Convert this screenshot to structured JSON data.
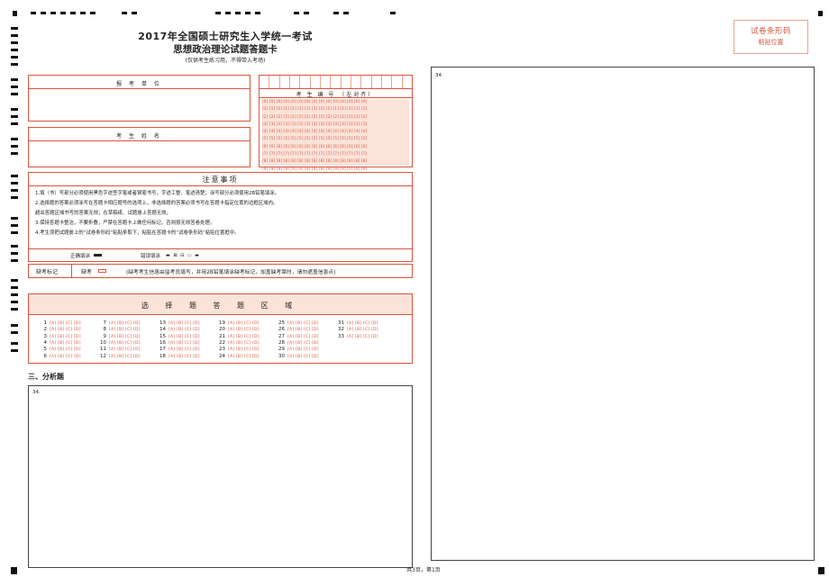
{
  "header": {
    "title_line1": "2017年全国硕士研究生入学统一考试",
    "title_line2": "思想政治理论试题答题卡",
    "subtitle": "(仅供考生练习用，不得带入考场)"
  },
  "barcode_area": {
    "line1": "试卷条形码",
    "line2": "粘贴位置"
  },
  "fields": {
    "exam_unit": "报 考 单 位",
    "candidate_name": "考 生 姓 名",
    "candidate_number": "考 生 编 号 （左对齐）"
  },
  "digit_rows": [
    "[0] [0] [0] [0] [0] [0] [0] [0] [0] [0] [0] [0] [0] [0] [0]",
    "[1] [1] [1] [1] [1] [1] [1] [1] [1] [1] [1] [1] [1] [1] [1]",
    "[2] [2] [2] [2] [2] [2] [2] [2] [2] [2] [2] [2] [2] [2] [2]",
    "[3] [3] [3] [3] [3] [3] [3] [3] [3] [3] [3] [3] [3] [3] [3]",
    "[4] [4] [4] [4] [4] [4] [4] [4] [4] [4] [4] [4] [4] [4] [4]",
    "[5] [5] [5] [5] [5] [5] [5] [5] [5] [5] [5] [5] [5] [5] [5]",
    "[6] [6] [6] [6] [6] [6] [6] [6] [6] [6] [6] [6] [6] [6] [6]",
    "[7] [7] [7] [7] [7] [7] [7] [7] [7] [7] [7] [7] [7] [7] [7]",
    "[8] [8] [8] [8] [8] [8] [8] [8] [8] [8] [8] [8] [8] [8] [8]",
    "[9] [9] [9] [9] [9] [9] [9] [9] [9] [9] [9] [9] [9] [9] [9]"
  ],
  "notices": {
    "title": "注意事项",
    "items": [
      "1.填（书）写部分必须使用黑色字迹签字笔或者钢笔书写，字迹工整、笔迹清楚；涂写部分必须使用2B铅笔填涂。",
      "2.选择题的答案必须涂写在答题卡相应题号的选项上，非选择题的答案必须书写在答题卡指定位置的边框区域内。",
      "   超出答题区域书写的答案无效；在草稿纸、试题册上答题无效。",
      "3.保持答题卡整洁，不要折叠，严禁在答题卡上做任何标记，否则按无效答卷处理。",
      "4.考生须把试题册上的“试卷条形码”粘贴条取下，粘贴在答题卡的“试卷条形码”粘贴位置框中。"
    ],
    "correct_fill": "正确填涂",
    "wrong_fill": "错误填涂"
  },
  "absence": {
    "label": "缺考标记",
    "mark": "缺考",
    "note": "(缺考考生信息由监考员填写，并用2B铅笔填涂缺考标记，加盖缺考章时，请勿遮盖信息点)"
  },
  "choice_section": {
    "title": "选 择 题 答 题 区 域",
    "options": "[A] [B] [C] [D]",
    "numbers": [
      "1",
      "2",
      "3",
      "4",
      "5",
      "6",
      "7",
      "8",
      "9",
      "10",
      "11",
      "12",
      "13",
      "14",
      "15",
      "16",
      "17",
      "18",
      "19",
      "20",
      "21",
      "22",
      "23",
      "24",
      "25",
      "26",
      "27",
      "28",
      "29",
      "30",
      "31",
      "32",
      "33"
    ]
  },
  "analysis": {
    "heading": "三、分析题",
    "q34_left": "34.",
    "q34_right": "34."
  },
  "footer": {
    "page": "共3页，第1页"
  }
}
